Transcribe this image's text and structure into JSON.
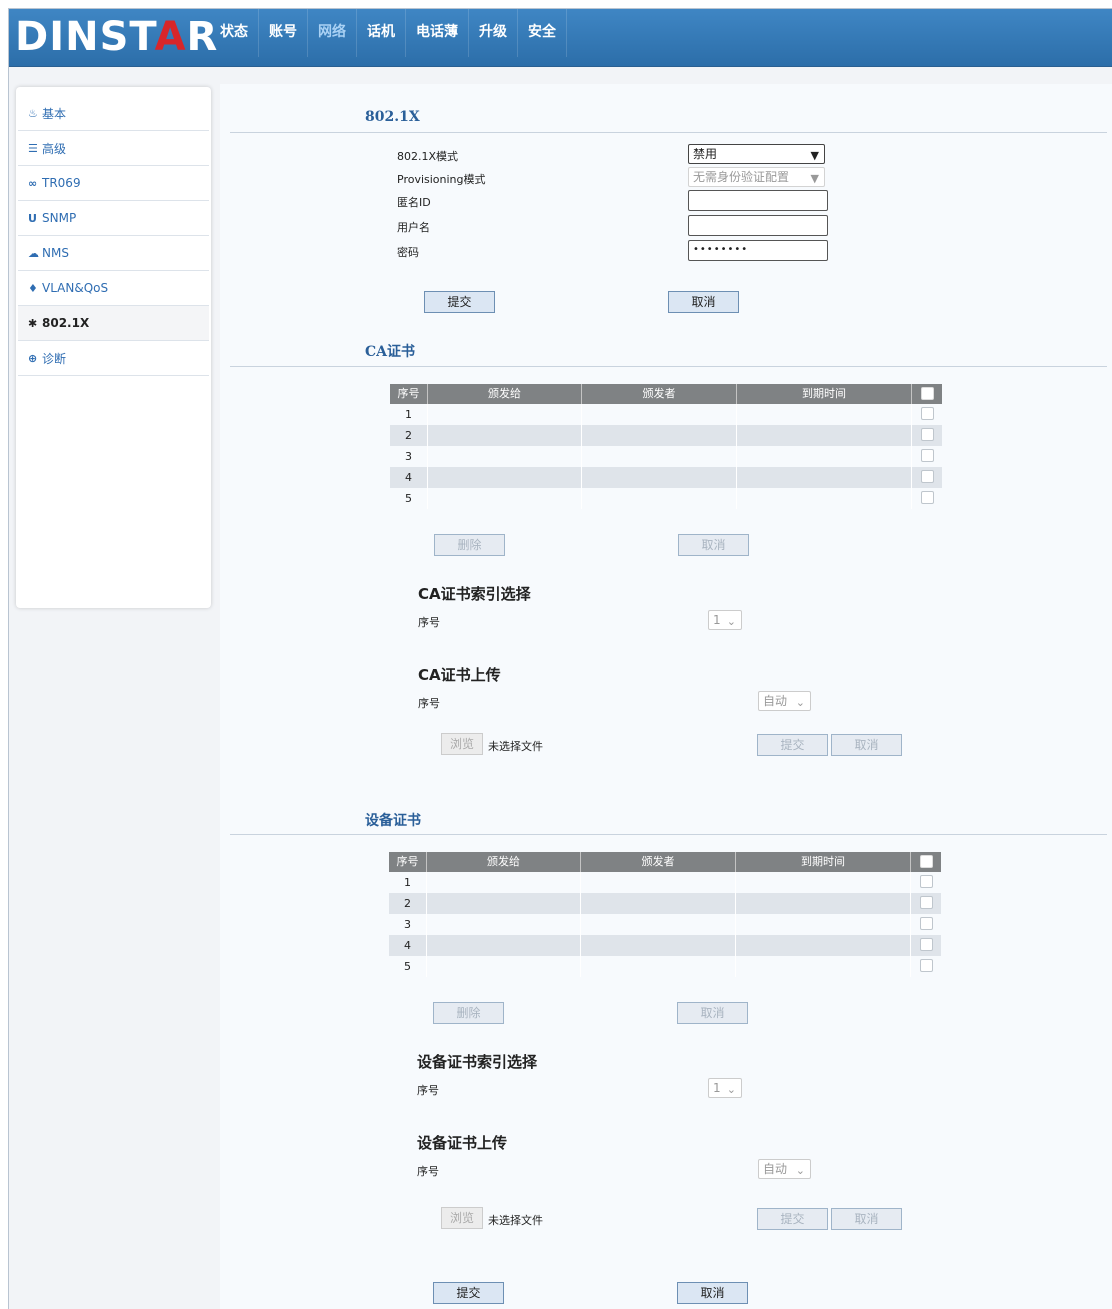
{
  "header": {
    "logo_left": "DINST",
    "logo_a": "A",
    "logo_right": "R",
    "nav": [
      "状态",
      "账号",
      "网络",
      "话机",
      "电话薄",
      "升级",
      "安全"
    ],
    "active_nav": "网络"
  },
  "sidebar": {
    "items": [
      {
        "label": "基本",
        "icon": "fire-icon",
        "glyph": "♨"
      },
      {
        "label": "高级",
        "icon": "list-icon",
        "glyph": "☰"
      },
      {
        "label": "TR069",
        "icon": "link-icon",
        "glyph": "∞"
      },
      {
        "label": "SNMP",
        "icon": "magnet-icon",
        "glyph": "U"
      },
      {
        "label": "NMS",
        "icon": "cloud-icon",
        "glyph": "☁"
      },
      {
        "label": "VLAN&QoS",
        "icon": "pin-icon",
        "glyph": "♦"
      },
      {
        "label": "802.1X",
        "icon": "asterisk-icon",
        "glyph": "✱"
      },
      {
        "label": "诊断",
        "icon": "zoom-icon",
        "glyph": "⊕"
      }
    ],
    "active": "802.1X"
  },
  "dot1x": {
    "title": "802.1X",
    "mode_label": "802.1X模式",
    "mode_value": "禁用",
    "prov_label": "Provisioning模式",
    "prov_value": "无需身份验证配置",
    "anon_label": "匿名ID",
    "anon_value": "",
    "user_label": "用户名",
    "user_value": "",
    "pass_label": "密码",
    "pass_value": "••••••••",
    "submit": "提交",
    "cancel": "取消"
  },
  "ca": {
    "title": "CA证书",
    "columns": [
      "序号",
      "颁发给",
      "颁发者",
      "到期时间"
    ],
    "rows": [
      "1",
      "2",
      "3",
      "4",
      "5"
    ],
    "delete": "删除",
    "cancel": "取消",
    "index_title": "CA证书索引选择",
    "index_label": "序号",
    "index_value": "1",
    "upload_title": "CA证书上传",
    "upload_label": "序号",
    "upload_value": "自动",
    "browse": "浏览",
    "nofile": "未选择文件",
    "upload_submit": "提交",
    "upload_cancel": "取消"
  },
  "dev": {
    "title": "设备证书",
    "columns": [
      "序号",
      "颁发给",
      "颁发者",
      "到期时间"
    ],
    "rows": [
      "1",
      "2",
      "3",
      "4",
      "5"
    ],
    "delete": "删除",
    "cancel": "取消",
    "index_title": "设备证书索引选择",
    "index_label": "序号",
    "index_value": "1",
    "upload_title": "设备证书上传",
    "upload_label": "序号",
    "upload_value": "自动",
    "browse": "浏览",
    "nofile": "未选择文件",
    "upload_submit": "提交",
    "upload_cancel": "取消"
  },
  "footer": {
    "submit": "提交",
    "cancel": "取消"
  }
}
